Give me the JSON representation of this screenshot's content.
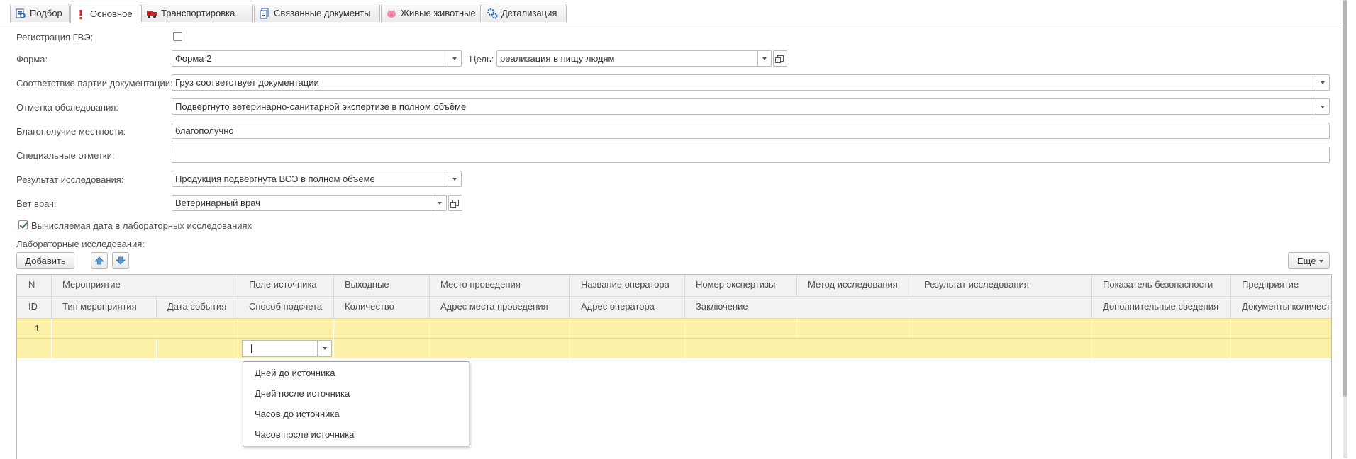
{
  "tabs": [
    {
      "label": "Подбор",
      "icon": "selection-icon"
    },
    {
      "label": "Основное",
      "icon": "exclamation-icon"
    },
    {
      "label": "Транспортировка",
      "icon": "truck-icon"
    },
    {
      "label": "Связанные документы",
      "icon": "documents-icon"
    },
    {
      "label": "Живые животные",
      "icon": "pig-icon"
    },
    {
      "label": "Детализация",
      "icon": "gears-icon"
    }
  ],
  "form": {
    "gve_label": "Регистрация ГВЭ:",
    "forma_label": "Форма:",
    "forma_value": "Форма 2",
    "tsel_label": "Цель:",
    "tsel_value": "реализация в пищу людям",
    "conformity_label": "Соответствие партии документации:",
    "conformity_value": "Груз соответствует документации",
    "inspection_label": "Отметка обследования:",
    "inspection_value": "Подвергнуто ветеринарно-санитарной экспертизе в полном объёме",
    "wellbeing_label": "Благополучие местности:",
    "wellbeing_value": "благополучно",
    "special_label": "Специальные отметки:",
    "special_value": "",
    "result_label": "Результат исследования:",
    "result_value": "Продукция подвергнута ВСЭ в полном объеме",
    "vet_label": "Вет врач:",
    "vet_value": "Ветеринарный врач",
    "computed_date_label": "Вычисляемая дата в лабораторных исследованиях",
    "lab_label": "Лабораторные исследования:"
  },
  "toolbar": {
    "add_label": "Добавить",
    "more_label": "Еще"
  },
  "table": {
    "header_row1": [
      "N",
      "Мероприятие",
      "Поле источника",
      "Выходные",
      "Место проведения",
      "Название оператора",
      "Номер экспертизы",
      "Метод исследования",
      "Результат исследования",
      "Показатель безопасности",
      "Предприятие"
    ],
    "header_row2": [
      "ID",
      "Тип мероприятия",
      "Дата события",
      "Способ подсчета",
      "Количество",
      "Адрес места проведения",
      "Адрес оператора",
      "Заключение",
      "Дополнительные сведения",
      "Документы количест"
    ],
    "row_number": "1"
  },
  "dropdown": {
    "options": [
      "Дней до источника",
      "Дней после источника",
      "Часов до источника",
      "Часов после источника"
    ]
  }
}
